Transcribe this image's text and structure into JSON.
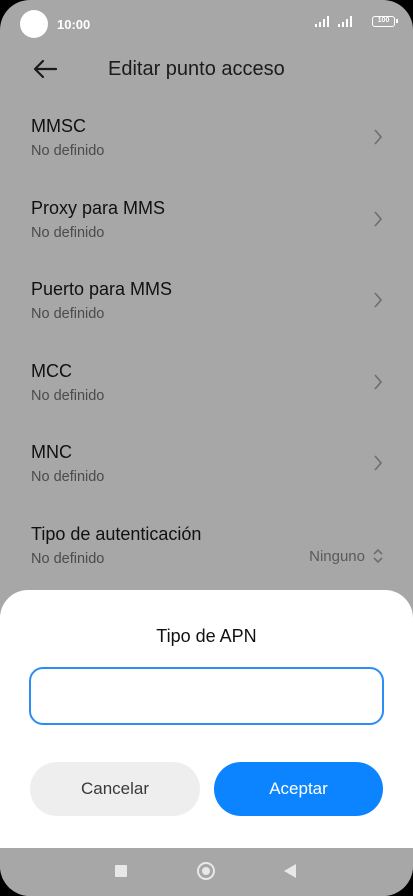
{
  "status_bar": {
    "time": "10:00",
    "battery": "100"
  },
  "header": {
    "title": "Editar punto acceso",
    "back_icon": "arrow-left-icon"
  },
  "settings": [
    {
      "title": "MMSC",
      "subtitle": "No definido",
      "icon": "chevron-right-icon"
    },
    {
      "title": "Proxy para MMS",
      "subtitle": "No definido",
      "icon": "chevron-right-icon"
    },
    {
      "title": "Puerto para MMS",
      "subtitle": "No definido",
      "icon": "chevron-right-icon"
    },
    {
      "title": "MCC",
      "subtitle": "No definido",
      "icon": "chevron-right-icon"
    },
    {
      "title": "MNC",
      "subtitle": "No definido",
      "icon": "chevron-right-icon"
    },
    {
      "title": "Tipo de autenticación",
      "subtitle": "No definido",
      "value": "Ninguno",
      "icon": "up-down-icon"
    }
  ],
  "dialog": {
    "title": "Tipo de APN",
    "input_value": "",
    "cancel_label": "Cancelar",
    "ok_label": "Aceptar"
  },
  "nav": {
    "icons": [
      "recents-square-icon",
      "home-circle-icon",
      "back-triangle-icon"
    ]
  },
  "colors": {
    "accent": "#0d84ff",
    "input_border": "#2a8ef5",
    "overlay": "#a7a7a7"
  }
}
